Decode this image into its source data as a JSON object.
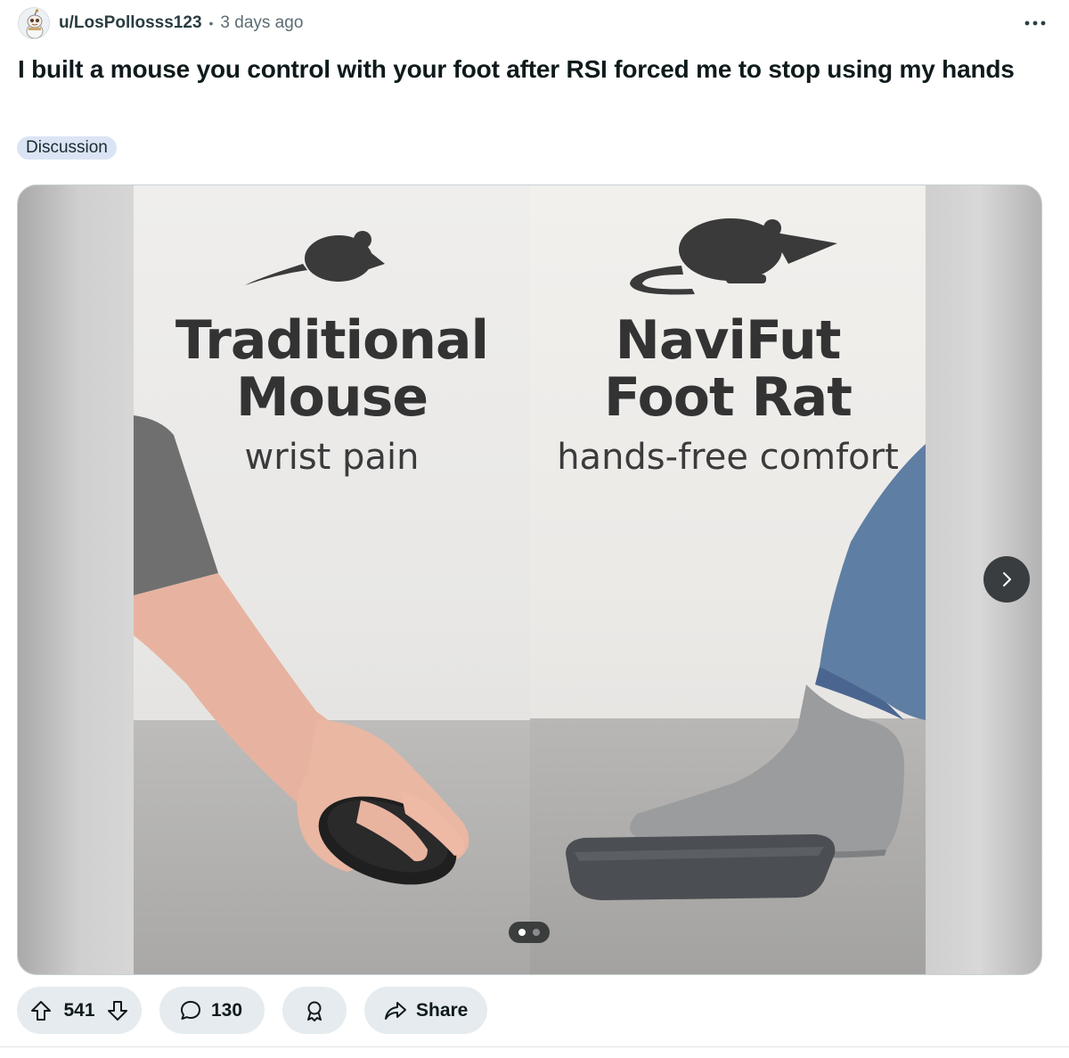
{
  "post": {
    "username": "u/LosPollosss123",
    "separator": "•",
    "timestamp": "3 days ago",
    "overflow_label": "...",
    "title": "I built a mouse you control with your foot after RSI forced me to stop using my hands",
    "flair": "Discussion"
  },
  "media": {
    "left_panel": {
      "heading_line1": "Traditional",
      "heading_line2": "Mouse",
      "subtitle": "wrist pain"
    },
    "right_panel": {
      "heading_line1": "NaviFut",
      "heading_line2": "Foot Rat",
      "subtitle": "hands-free comfort"
    },
    "pager": {
      "current": 1,
      "total": 2
    }
  },
  "actions": {
    "upvotes": "541",
    "comments": "130",
    "share_label": "Share"
  },
  "icons": {
    "upvote": "arrow-up-icon",
    "downvote": "arrow-down-icon",
    "comment": "speech-bubble-icon",
    "award": "award-ribbon-icon",
    "share": "share-arrow-icon",
    "next": "chevron-right-icon",
    "overflow": "ellipsis-icon"
  },
  "colors": {
    "action_bg": "#e5ebee",
    "flair_bg": "#dbe4f5",
    "text_primary": "#0f1a1c",
    "text_secondary": "#5c6c74"
  }
}
